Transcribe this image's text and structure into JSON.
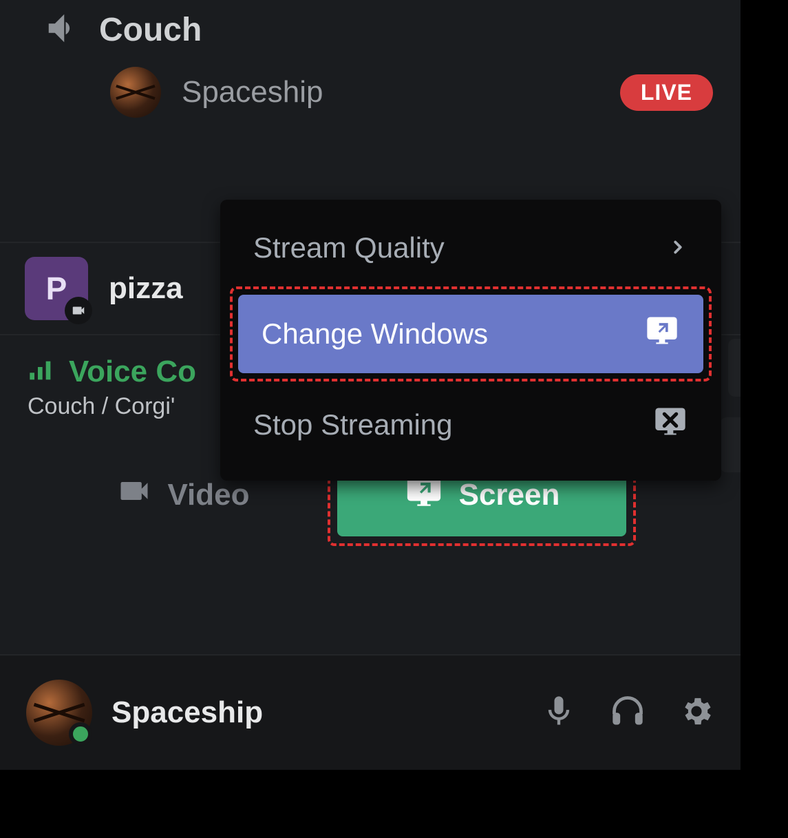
{
  "channel": {
    "name": "Couch"
  },
  "member": {
    "name": "Spaceship",
    "live_badge": "LIVE"
  },
  "streaming_app": {
    "initial": "P",
    "label": "pizza"
  },
  "voice": {
    "status_text": "Voice Co",
    "path": "Couch / Corgi'"
  },
  "buttons": {
    "video": "Video",
    "screen": "Screen"
  },
  "context_menu": {
    "stream_quality": "Stream Quality",
    "change_windows": "Change Windows",
    "stop_streaming": "Stop Streaming"
  },
  "user_panel": {
    "name": "Spaceship"
  }
}
